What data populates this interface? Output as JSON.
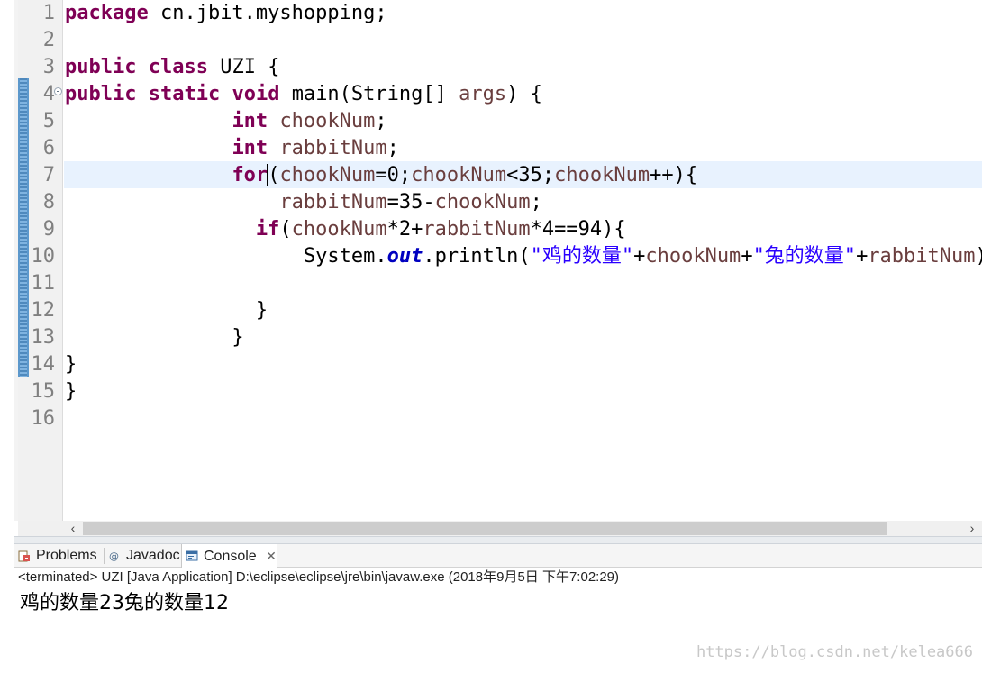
{
  "editor": {
    "line_numbers": [
      "1",
      "2",
      "3",
      "4",
      "5",
      "6",
      "7",
      "8",
      "9",
      "10",
      "11",
      "12",
      "13",
      "14",
      "15",
      "16"
    ],
    "lines": [
      [
        {
          "t": "package",
          "c": "kw"
        },
        {
          "t": " cn.jbit.myshopping;"
        }
      ],
      [],
      [
        {
          "t": "public",
          "c": "kw"
        },
        {
          "t": " "
        },
        {
          "t": "class",
          "c": "kw"
        },
        {
          "t": " UZI {"
        }
      ],
      [
        {
          "t": "public",
          "c": "kw"
        },
        {
          "t": " "
        },
        {
          "t": "static",
          "c": "kw"
        },
        {
          "t": " "
        },
        {
          "t": "void",
          "c": "kw"
        },
        {
          "t": " main(String[] "
        },
        {
          "t": "args",
          "c": "var"
        },
        {
          "t": ") {"
        }
      ],
      [
        {
          "t": "              "
        },
        {
          "t": "int",
          "c": "kw"
        },
        {
          "t": " "
        },
        {
          "t": "chookNum",
          "c": "var"
        },
        {
          "t": ";"
        }
      ],
      [
        {
          "t": "              "
        },
        {
          "t": "int",
          "c": "kw"
        },
        {
          "t": " "
        },
        {
          "t": "rabbitNum",
          "c": "var"
        },
        {
          "t": ";"
        }
      ],
      [
        {
          "t": "              "
        },
        {
          "t": "for",
          "c": "kw"
        },
        {
          "t": "(",
          "c": "caret"
        },
        {
          "t": "chookNum",
          "c": "var"
        },
        {
          "t": "=0;"
        },
        {
          "t": "chookNum",
          "c": "var"
        },
        {
          "t": "<35;"
        },
        {
          "t": "chookNum",
          "c": "var"
        },
        {
          "t": "++){"
        }
      ],
      [
        {
          "t": "                  "
        },
        {
          "t": "rabbitNum",
          "c": "var"
        },
        {
          "t": "=35-"
        },
        {
          "t": "chookNum",
          "c": "var"
        },
        {
          "t": ";"
        }
      ],
      [
        {
          "t": "                "
        },
        {
          "t": "if",
          "c": "kw"
        },
        {
          "t": "("
        },
        {
          "t": "chookNum",
          "c": "var"
        },
        {
          "t": "*2+"
        },
        {
          "t": "rabbitNum",
          "c": "var"
        },
        {
          "t": "*4==94){"
        }
      ],
      [
        {
          "t": "                    System."
        },
        {
          "t": "out",
          "c": "fld"
        },
        {
          "t": ".println("
        },
        {
          "t": "\"鸡的数量\"",
          "c": "str"
        },
        {
          "t": "+"
        },
        {
          "t": "chookNum",
          "c": "var"
        },
        {
          "t": "+"
        },
        {
          "t": "\"兔的数量\"",
          "c": "str"
        },
        {
          "t": "+"
        },
        {
          "t": "rabbitNum",
          "c": "var"
        },
        {
          "t": ");"
        }
      ],
      [],
      [
        {
          "t": "                }"
        }
      ],
      [
        {
          "t": "              }"
        }
      ],
      [
        {
          "t": "}"
        }
      ],
      [
        {
          "t": "}"
        }
      ],
      []
    ]
  },
  "scrollbar": {
    "left_arrow": "‹",
    "right_arrow": "›"
  },
  "tabs": [
    {
      "label": "Problems",
      "icon": "problems-icon"
    },
    {
      "label": "Javadoc",
      "icon": "javadoc-icon"
    },
    {
      "label": "Console",
      "icon": "console-icon",
      "close": "✕"
    }
  ],
  "console": {
    "header": "<terminated> UZI [Java Application] D:\\eclipse\\eclipse\\jre\\bin\\javaw.exe (2018年9月5日 下午7:02:29)",
    "output": "鸡的数量23兔的数量12"
  },
  "watermark": "https://blog.csdn.net/kelea666",
  "colors": {
    "keyword": "#7f0055",
    "variable": "#6a3e3e",
    "string": "#2a00ff",
    "field": "#0000c0",
    "current_line": "#e8f2fe",
    "change_bar": "#5c98cc"
  }
}
